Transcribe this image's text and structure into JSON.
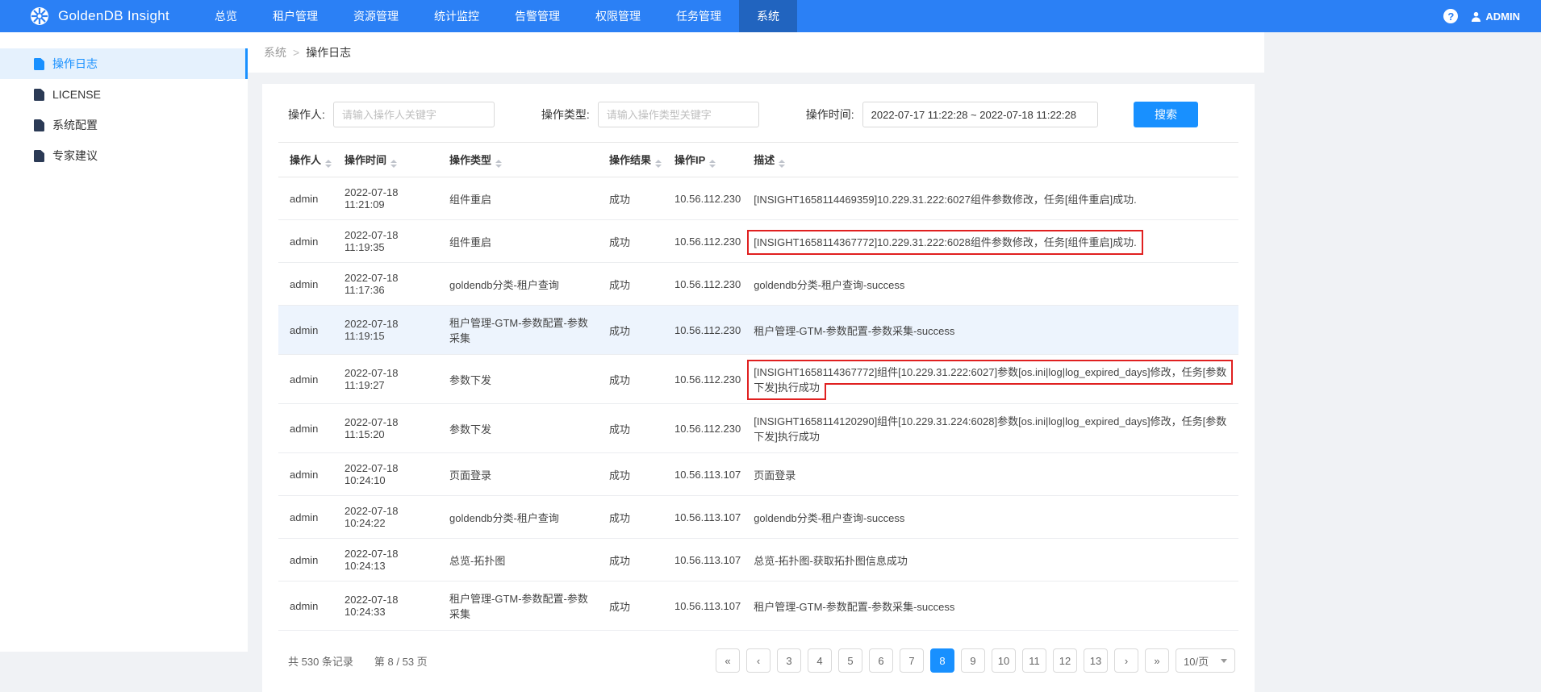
{
  "header": {
    "app_title": "GoldenDB Insight",
    "nav": [
      {
        "label": "总览"
      },
      {
        "label": "租户管理"
      },
      {
        "label": "资源管理"
      },
      {
        "label": "统计监控"
      },
      {
        "label": "告警管理"
      },
      {
        "label": "权限管理"
      },
      {
        "label": "任务管理"
      },
      {
        "label": "系统",
        "active": true
      }
    ],
    "help_icon": "?",
    "user_label": "ADMIN"
  },
  "sidebar": {
    "items": [
      {
        "label": "操作日志",
        "active": true
      },
      {
        "label": "LICENSE"
      },
      {
        "label": "系统配置"
      },
      {
        "label": "专家建议"
      }
    ]
  },
  "breadcrumb": {
    "parent": "系统",
    "separator": ">",
    "current": "操作日志"
  },
  "filters": {
    "operator_label": "操作人:",
    "operator_placeholder": "请输入操作人关键字",
    "type_label": "操作类型:",
    "type_placeholder": "请输入操作类型关键字",
    "time_label": "操作时间:",
    "time_value": "2022-07-17 11:22:28 ~ 2022-07-18 11:22:28",
    "search_label": "搜索"
  },
  "table": {
    "columns": [
      "操作人",
      "操作时间",
      "操作类型",
      "操作结果",
      "操作IP",
      "描述"
    ],
    "rows": [
      {
        "operator": "admin",
        "time": "2022-07-18 11:21:09",
        "type": "组件重启",
        "result": "成功",
        "ip": "10.56.112.230",
        "desc": "[INSIGHT1658114469359]10.229.31.222:6027组件参数修改，任务[组件重启]成功."
      },
      {
        "operator": "admin",
        "time": "2022-07-18 11:19:35",
        "type": "组件重启",
        "result": "成功",
        "ip": "10.56.112.230",
        "desc": "[INSIGHT1658114367772]10.229.31.222:6028组件参数修改，任务[组件重启]成功.",
        "red_box": true
      },
      {
        "operator": "admin",
        "time": "2022-07-18 11:17:36",
        "type": "goldendb分类-租户查询",
        "result": "成功",
        "ip": "10.56.112.230",
        "desc": "goldendb分类-租户查询-success"
      },
      {
        "operator": "admin",
        "time": "2022-07-18 11:19:15",
        "type": "租户管理-GTM-参数配置-参数采集",
        "result": "成功",
        "ip": "10.56.112.230",
        "desc": "租户管理-GTM-参数配置-参数采集-success",
        "highlight_row": true
      },
      {
        "operator": "admin",
        "time": "2022-07-18 11:19:27",
        "type": "参数下发",
        "result": "成功",
        "ip": "10.56.112.230",
        "desc": "[INSIGHT1658114367772]组件[10.229.31.222:6027]参数[os.ini|log|log_expired_days]修改，任务[参数下发]执行成功",
        "red_box": true
      },
      {
        "operator": "admin",
        "time": "2022-07-18 11:15:20",
        "type": "参数下发",
        "result": "成功",
        "ip": "10.56.112.230",
        "desc": "[INSIGHT1658114120290]组件[10.229.31.224:6028]参数[os.ini|log|log_expired_days]修改，任务[参数下发]执行成功"
      },
      {
        "operator": "admin",
        "time": "2022-07-18 10:24:10",
        "type": "页面登录",
        "result": "成功",
        "ip": "10.56.113.107",
        "desc": "页面登录"
      },
      {
        "operator": "admin",
        "time": "2022-07-18 10:24:22",
        "type": "goldendb分类-租户查询",
        "result": "成功",
        "ip": "10.56.113.107",
        "desc": "goldendb分类-租户查询-success"
      },
      {
        "operator": "admin",
        "time": "2022-07-18 10:24:13",
        "type": "总览-拓扑图",
        "result": "成功",
        "ip": "10.56.113.107",
        "desc": "总览-拓扑图-获取拓扑图信息成功"
      },
      {
        "operator": "admin",
        "time": "2022-07-18 10:24:33",
        "type": "租户管理-GTM-参数配置-参数采集",
        "result": "成功",
        "ip": "10.56.113.107",
        "desc": "租户管理-GTM-参数配置-参数采集-success"
      }
    ]
  },
  "footer": {
    "total_text": "共 530 条记录",
    "page_text": "第 8 / 53 页"
  },
  "pagination": {
    "items": [
      {
        "type": "first",
        "label": "«"
      },
      {
        "type": "prev",
        "label": "‹"
      },
      {
        "type": "page",
        "label": "3"
      },
      {
        "type": "page",
        "label": "4"
      },
      {
        "type": "page",
        "label": "5"
      },
      {
        "type": "page",
        "label": "6"
      },
      {
        "type": "page",
        "label": "7"
      },
      {
        "type": "page",
        "label": "8",
        "active": true
      },
      {
        "type": "page",
        "label": "9"
      },
      {
        "type": "page",
        "label": "10"
      },
      {
        "type": "page",
        "label": "11"
      },
      {
        "type": "page",
        "label": "12"
      },
      {
        "type": "page",
        "label": "13"
      },
      {
        "type": "next",
        "label": "›"
      },
      {
        "type": "last",
        "label": "»"
      }
    ],
    "page_size": "10/页"
  },
  "colors": {
    "accent": "#1890ff",
    "header_bg": "#2b80f5",
    "annotation": "#e02020"
  }
}
